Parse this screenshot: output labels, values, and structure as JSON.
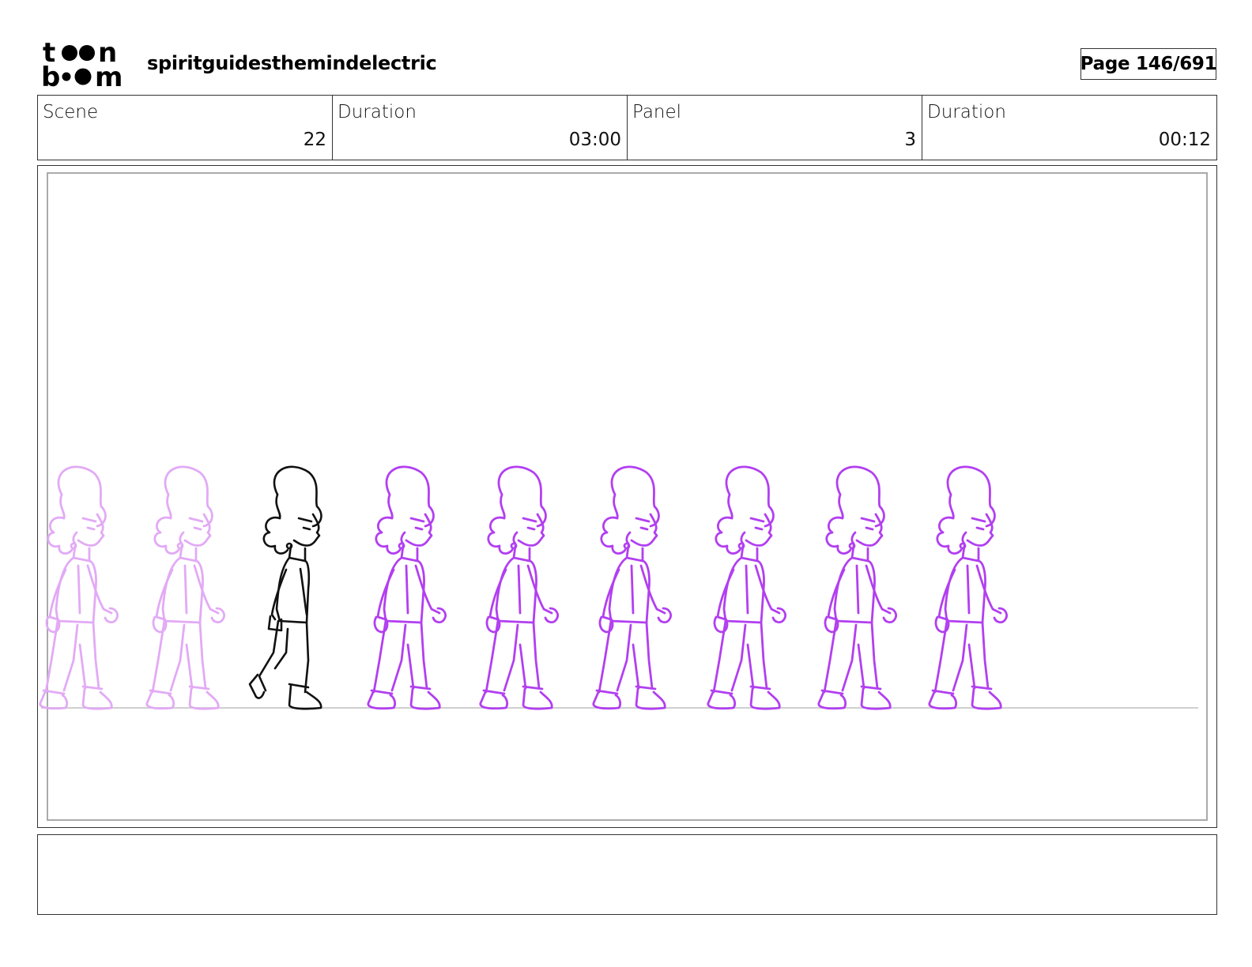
{
  "header": {
    "logo_icon": "toonboom-logo-icon",
    "project_title": "spiritguidesthemindelectric",
    "page_label": "Page 146/691"
  },
  "info": {
    "scene_label": "Scene",
    "scene_value": "22",
    "scene_duration_label": "Duration",
    "scene_duration_value": "03:00",
    "panel_label": "Panel",
    "panel_value": "3",
    "panel_duration_label": "Duration",
    "panel_duration_value": "00:12"
  },
  "panel": {
    "figures": [
      {
        "style": "ghost-faint"
      },
      {
        "style": "ghost-faint"
      },
      {
        "style": "key"
      },
      {
        "style": "ghost"
      },
      {
        "style": "ghost"
      },
      {
        "style": "ghost"
      },
      {
        "style": "ghost"
      },
      {
        "style": "ghost"
      },
      {
        "style": "ghost"
      }
    ]
  },
  "colors": {
    "key_line": "#111111",
    "ghost_line": "#b23ff0",
    "ghost_faint_line": "#e2aaf5",
    "ground_line": "#cfcfcf"
  },
  "notes": {}
}
